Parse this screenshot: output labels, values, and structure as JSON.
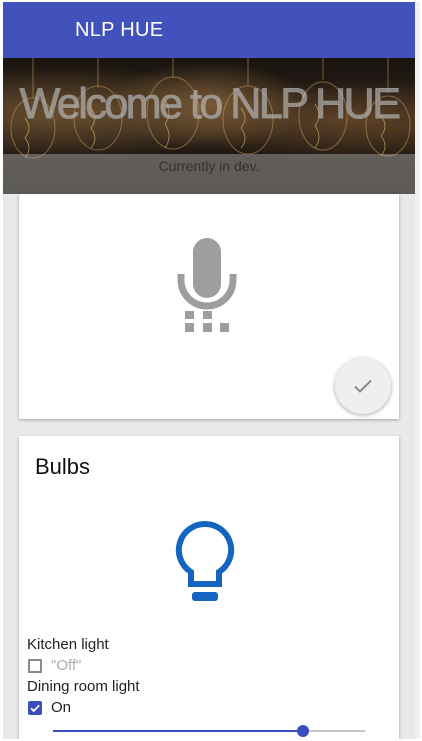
{
  "app": {
    "title": "NLP HUE"
  },
  "hero": {
    "title": "Welcome to NLP HUE",
    "subtitle": "Currently in dev."
  },
  "voice_card": {
    "mic_icon": "microphone-icon",
    "fab_icon": "check-icon"
  },
  "bulbs_card": {
    "title": "Bulbs",
    "icon": "lightbulb-icon",
    "lights": [
      {
        "name": "Kitchen light",
        "state": "\"Off\"",
        "checked": false
      },
      {
        "name": "Dining room light",
        "state": "On",
        "checked": true,
        "brightness": 0.8
      }
    ]
  },
  "colors": {
    "appbar": "#4152bc",
    "accent": "#3b4dbd",
    "bulb_icon": "#1565c0",
    "mic_icon": "#9e9e9e"
  }
}
